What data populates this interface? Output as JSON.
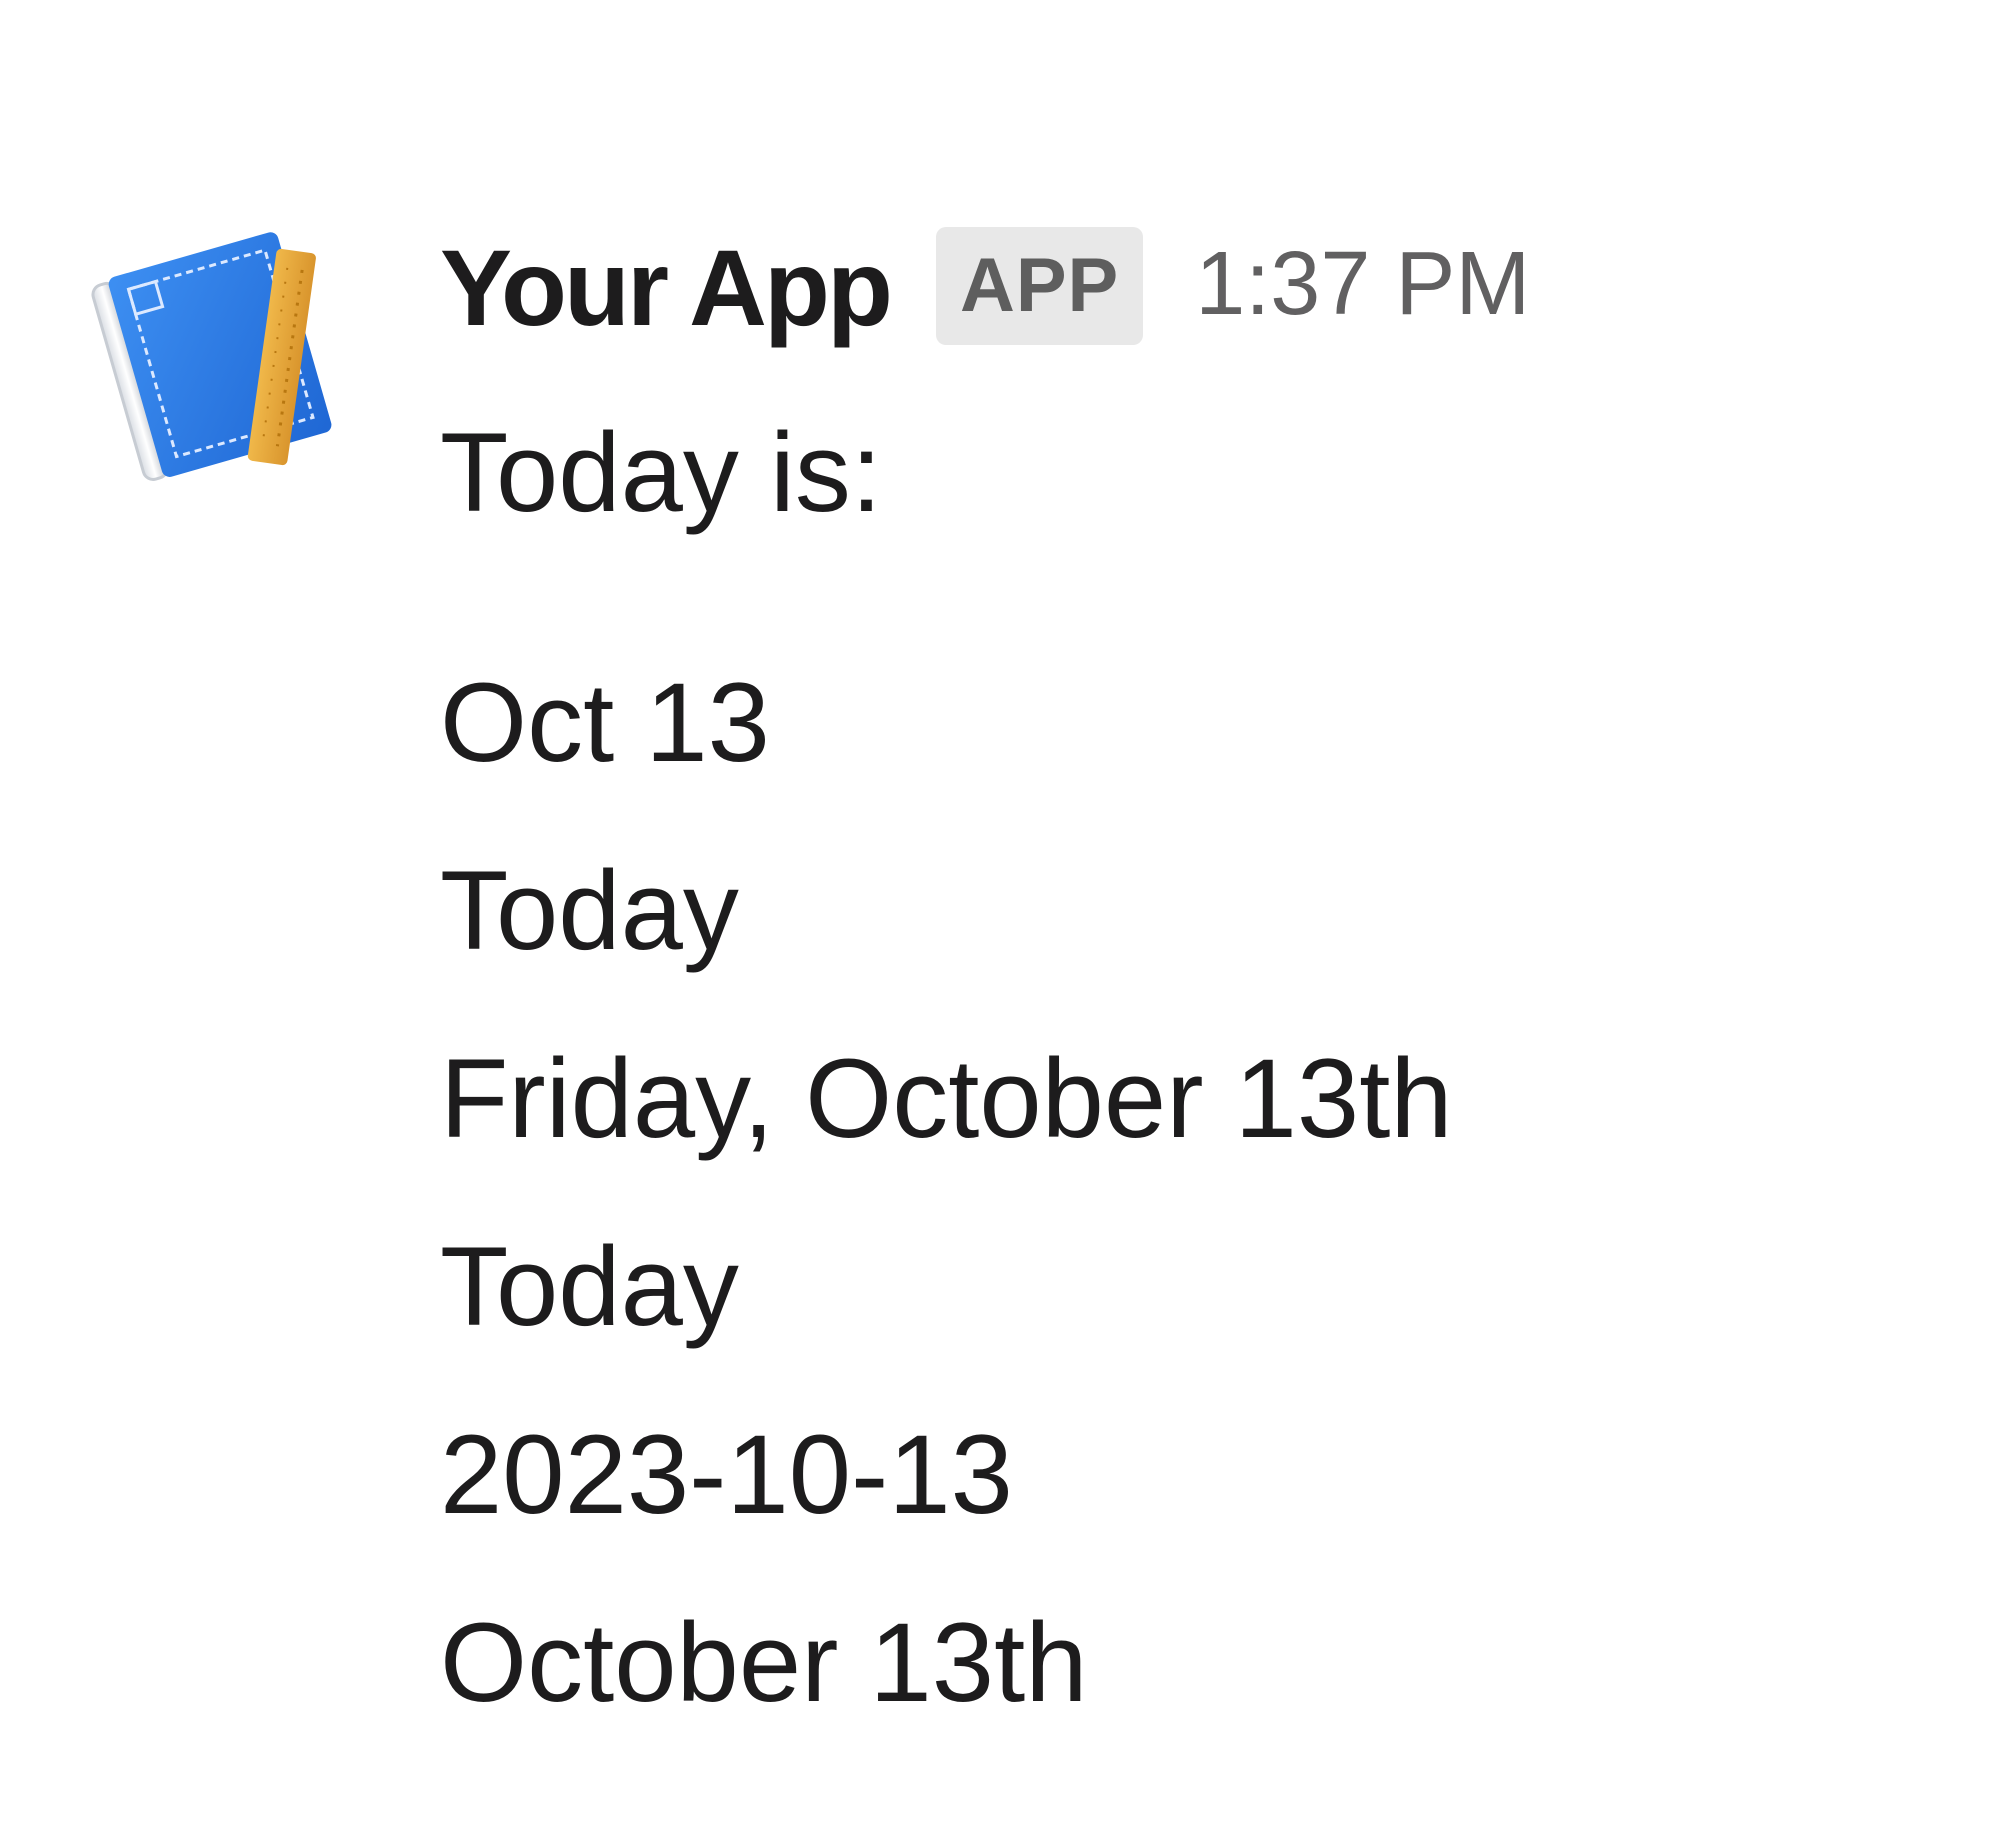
{
  "message": {
    "sender": "Your App",
    "badge": "APP",
    "timestamp": "1:37 PM",
    "avatar_icon": "app-book-ruler-icon",
    "intro": "Today is:",
    "date_lines": [
      "Oct 13",
      "Today",
      "Friday, October 13th",
      "Today",
      "2023-10-13",
      "October 13th"
    ]
  },
  "colors": {
    "text": "#1d1c1d",
    "timestamp": "#616061",
    "badge_bg": "#e8e8e8",
    "badge_text": "#5e5e5e",
    "avatar_blue": "#2a7be4",
    "avatar_ruler": "#e8aa3c"
  }
}
